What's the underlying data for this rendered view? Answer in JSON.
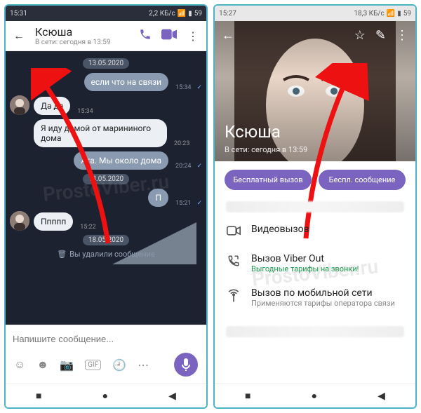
{
  "left": {
    "status": {
      "time": "15:31",
      "net": "2,2 КБ/с",
      "batt": "59"
    },
    "header": {
      "title": "Ксюша",
      "subtitle": "В сети: сегодня в 13:59"
    },
    "dates": {
      "d1": "13.05.2020",
      "d2": "14.05.2020",
      "d3": "18.05.2020"
    },
    "msgs": {
      "m1": {
        "text": "если что на связи",
        "time": "15:34"
      },
      "m2": {
        "text": "Да да",
        "time": "15:34"
      },
      "m3": {
        "text": "Я иду домой от марининого дома",
        "time": "20:23"
      },
      "m4": {
        "text": "Ага. Мы около дома",
        "time": "20:24"
      },
      "m5": {
        "text": "П",
        "time": "15:21"
      },
      "m6": {
        "text": "Ппппп",
        "time": "15:22"
      }
    },
    "deleted": {
      "icon": "🗑",
      "text": "Вы удалили сообщение"
    },
    "composer": {
      "placeholder": "Напишите сообщение..."
    }
  },
  "right": {
    "status": {
      "time": "15:27",
      "net": "18,3 КБ/с",
      "batt": "59"
    },
    "hero": {
      "title": "Ксюша",
      "subtitle": "В сети: сегодня в 13:59"
    },
    "pills": {
      "call": "Бесплатный вызов",
      "msg": "Беспл. сообщение"
    },
    "options": {
      "video": {
        "title": "Видеовызов"
      },
      "viberout": {
        "title": "Вызов Viber Out",
        "sub": "Выгодные тарифы на звонки!"
      },
      "cellular": {
        "title": "Вызов по мобильной сети",
        "sub": "Применяются тарифы оператора связи"
      }
    }
  },
  "watermark": "ProstoViber.ru"
}
